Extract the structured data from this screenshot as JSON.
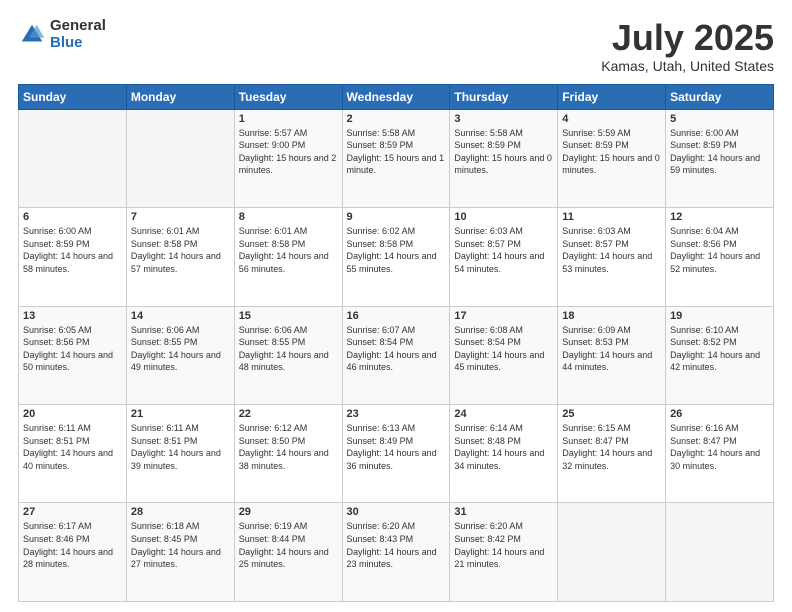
{
  "logo": {
    "general": "General",
    "blue": "Blue"
  },
  "title": {
    "month_year": "July 2025",
    "location": "Kamas, Utah, United States"
  },
  "days_of_week": [
    "Sunday",
    "Monday",
    "Tuesday",
    "Wednesday",
    "Thursday",
    "Friday",
    "Saturday"
  ],
  "weeks": [
    [
      {
        "day": "",
        "sunrise": "",
        "sunset": "",
        "daylight": "",
        "empty": true
      },
      {
        "day": "",
        "sunrise": "",
        "sunset": "",
        "daylight": "",
        "empty": true
      },
      {
        "day": "1",
        "sunrise": "Sunrise: 5:57 AM",
        "sunset": "Sunset: 9:00 PM",
        "daylight": "Daylight: 15 hours and 2 minutes."
      },
      {
        "day": "2",
        "sunrise": "Sunrise: 5:58 AM",
        "sunset": "Sunset: 8:59 PM",
        "daylight": "Daylight: 15 hours and 1 minute."
      },
      {
        "day": "3",
        "sunrise": "Sunrise: 5:58 AM",
        "sunset": "Sunset: 8:59 PM",
        "daylight": "Daylight: 15 hours and 0 minutes."
      },
      {
        "day": "4",
        "sunrise": "Sunrise: 5:59 AM",
        "sunset": "Sunset: 8:59 PM",
        "daylight": "Daylight: 15 hours and 0 minutes."
      },
      {
        "day": "5",
        "sunrise": "Sunrise: 6:00 AM",
        "sunset": "Sunset: 8:59 PM",
        "daylight": "Daylight: 14 hours and 59 minutes."
      }
    ],
    [
      {
        "day": "6",
        "sunrise": "Sunrise: 6:00 AM",
        "sunset": "Sunset: 8:59 PM",
        "daylight": "Daylight: 14 hours and 58 minutes."
      },
      {
        "day": "7",
        "sunrise": "Sunrise: 6:01 AM",
        "sunset": "Sunset: 8:58 PM",
        "daylight": "Daylight: 14 hours and 57 minutes."
      },
      {
        "day": "8",
        "sunrise": "Sunrise: 6:01 AM",
        "sunset": "Sunset: 8:58 PM",
        "daylight": "Daylight: 14 hours and 56 minutes."
      },
      {
        "day": "9",
        "sunrise": "Sunrise: 6:02 AM",
        "sunset": "Sunset: 8:58 PM",
        "daylight": "Daylight: 14 hours and 55 minutes."
      },
      {
        "day": "10",
        "sunrise": "Sunrise: 6:03 AM",
        "sunset": "Sunset: 8:57 PM",
        "daylight": "Daylight: 14 hours and 54 minutes."
      },
      {
        "day": "11",
        "sunrise": "Sunrise: 6:03 AM",
        "sunset": "Sunset: 8:57 PM",
        "daylight": "Daylight: 14 hours and 53 minutes."
      },
      {
        "day": "12",
        "sunrise": "Sunrise: 6:04 AM",
        "sunset": "Sunset: 8:56 PM",
        "daylight": "Daylight: 14 hours and 52 minutes."
      }
    ],
    [
      {
        "day": "13",
        "sunrise": "Sunrise: 6:05 AM",
        "sunset": "Sunset: 8:56 PM",
        "daylight": "Daylight: 14 hours and 50 minutes."
      },
      {
        "day": "14",
        "sunrise": "Sunrise: 6:06 AM",
        "sunset": "Sunset: 8:55 PM",
        "daylight": "Daylight: 14 hours and 49 minutes."
      },
      {
        "day": "15",
        "sunrise": "Sunrise: 6:06 AM",
        "sunset": "Sunset: 8:55 PM",
        "daylight": "Daylight: 14 hours and 48 minutes."
      },
      {
        "day": "16",
        "sunrise": "Sunrise: 6:07 AM",
        "sunset": "Sunset: 8:54 PM",
        "daylight": "Daylight: 14 hours and 46 minutes."
      },
      {
        "day": "17",
        "sunrise": "Sunrise: 6:08 AM",
        "sunset": "Sunset: 8:54 PM",
        "daylight": "Daylight: 14 hours and 45 minutes."
      },
      {
        "day": "18",
        "sunrise": "Sunrise: 6:09 AM",
        "sunset": "Sunset: 8:53 PM",
        "daylight": "Daylight: 14 hours and 44 minutes."
      },
      {
        "day": "19",
        "sunrise": "Sunrise: 6:10 AM",
        "sunset": "Sunset: 8:52 PM",
        "daylight": "Daylight: 14 hours and 42 minutes."
      }
    ],
    [
      {
        "day": "20",
        "sunrise": "Sunrise: 6:11 AM",
        "sunset": "Sunset: 8:51 PM",
        "daylight": "Daylight: 14 hours and 40 minutes."
      },
      {
        "day": "21",
        "sunrise": "Sunrise: 6:11 AM",
        "sunset": "Sunset: 8:51 PM",
        "daylight": "Daylight: 14 hours and 39 minutes."
      },
      {
        "day": "22",
        "sunrise": "Sunrise: 6:12 AM",
        "sunset": "Sunset: 8:50 PM",
        "daylight": "Daylight: 14 hours and 38 minutes."
      },
      {
        "day": "23",
        "sunrise": "Sunrise: 6:13 AM",
        "sunset": "Sunset: 8:49 PM",
        "daylight": "Daylight: 14 hours and 36 minutes."
      },
      {
        "day": "24",
        "sunrise": "Sunrise: 6:14 AM",
        "sunset": "Sunset: 8:48 PM",
        "daylight": "Daylight: 14 hours and 34 minutes."
      },
      {
        "day": "25",
        "sunrise": "Sunrise: 6:15 AM",
        "sunset": "Sunset: 8:47 PM",
        "daylight": "Daylight: 14 hours and 32 minutes."
      },
      {
        "day": "26",
        "sunrise": "Sunrise: 6:16 AM",
        "sunset": "Sunset: 8:47 PM",
        "daylight": "Daylight: 14 hours and 30 minutes."
      }
    ],
    [
      {
        "day": "27",
        "sunrise": "Sunrise: 6:17 AM",
        "sunset": "Sunset: 8:46 PM",
        "daylight": "Daylight: 14 hours and 28 minutes."
      },
      {
        "day": "28",
        "sunrise": "Sunrise: 6:18 AM",
        "sunset": "Sunset: 8:45 PM",
        "daylight": "Daylight: 14 hours and 27 minutes."
      },
      {
        "day": "29",
        "sunrise": "Sunrise: 6:19 AM",
        "sunset": "Sunset: 8:44 PM",
        "daylight": "Daylight: 14 hours and 25 minutes."
      },
      {
        "day": "30",
        "sunrise": "Sunrise: 6:20 AM",
        "sunset": "Sunset: 8:43 PM",
        "daylight": "Daylight: 14 hours and 23 minutes."
      },
      {
        "day": "31",
        "sunrise": "Sunrise: 6:20 AM",
        "sunset": "Sunset: 8:42 PM",
        "daylight": "Daylight: 14 hours and 21 minutes."
      },
      {
        "day": "",
        "sunrise": "",
        "sunset": "",
        "daylight": "",
        "empty": true
      },
      {
        "day": "",
        "sunrise": "",
        "sunset": "",
        "daylight": "",
        "empty": true
      }
    ]
  ]
}
